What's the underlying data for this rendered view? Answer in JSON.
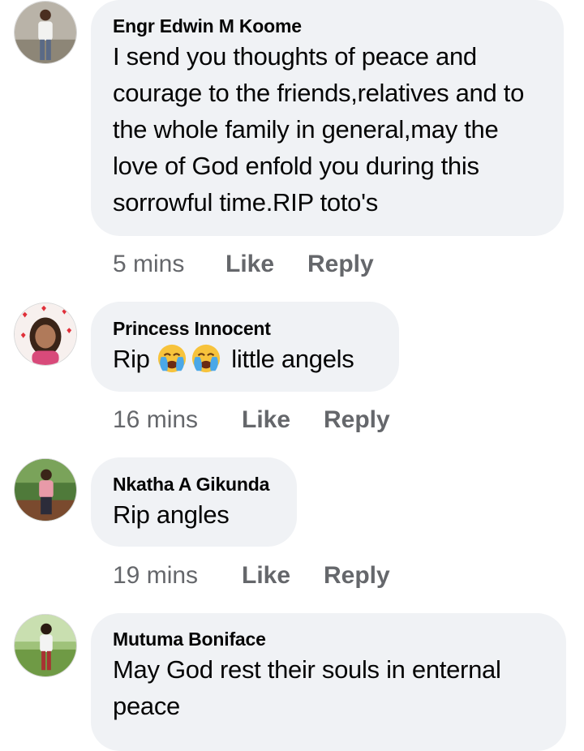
{
  "comments": [
    {
      "author": "Engr Edwin M Koome",
      "text": "I send you thoughts of peace and courage to the friends,relatives and to the whole family in general,may the love of God enfold you during this sorrowful time.RIP toto's",
      "time": "5 mins",
      "like_label": "Like",
      "reply_label": "Reply"
    },
    {
      "author": "Princess Innocent",
      "text_before": "Rip",
      "emojis": [
        "loudly-crying-face",
        "loudly-crying-face"
      ],
      "text_after": "little angels",
      "time": "16 mins",
      "like_label": "Like",
      "reply_label": "Reply"
    },
    {
      "author": "Nkatha A Gikunda",
      "text": "Rip angles",
      "time": "19 mins",
      "like_label": "Like",
      "reply_label": "Reply"
    },
    {
      "author": "Mutuma Boniface",
      "text": "May God rest their souls in enternal peace"
    }
  ],
  "colors": {
    "bubble": "#f0f2f5",
    "meta_text": "#65676b",
    "text": "#050505"
  }
}
